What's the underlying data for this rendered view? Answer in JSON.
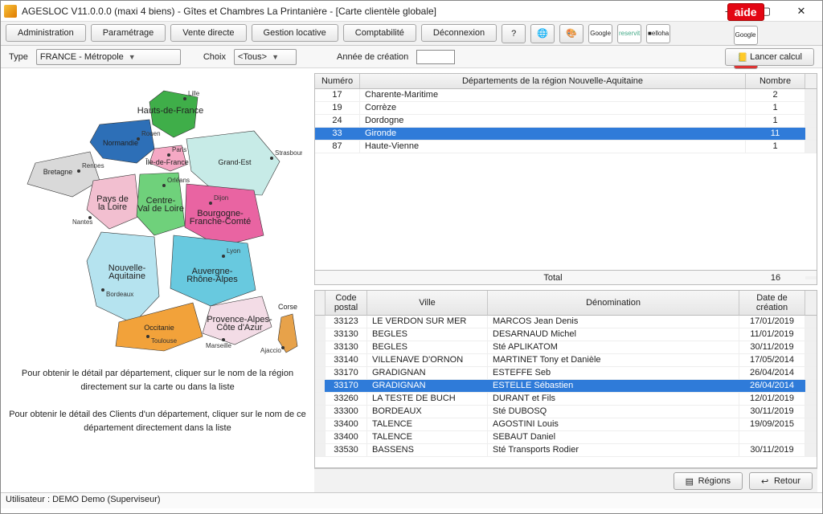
{
  "window": {
    "title": "AGESLOC V11.0.0.0 (maxi 4 biens) - Gîtes et Chambres La Printanière - [Carte clientèle globale]"
  },
  "toolbar": {
    "admin": "Administration",
    "param": "Paramétrage",
    "vente": "Vente directe",
    "gestion": "Gestion locative",
    "compta": "Comptabilité",
    "deco": "Déconnexion",
    "help": "?",
    "aide": "aide"
  },
  "logos": {
    "google": "Google",
    "reservit": "reservit",
    "elloha": "■elloha"
  },
  "filter": {
    "type_label": "Type",
    "type_value": "FRANCE - Métropole",
    "choix_label": "Choix",
    "choix_value": "<Tous>",
    "annee_label": "Année de création",
    "lancer": "Lancer calcul"
  },
  "hint1": "Pour obtenir le détail par département, cliquer sur le nom de la région directement sur la carte ou dans la liste",
  "hint2": "Pour obtenir le détail des Clients d'un département, cliquer sur le nom de ce département directement dans la liste",
  "grid1": {
    "col_num": "Numéro",
    "col_dep": "Départements de la région Nouvelle-Aquitaine",
    "col_nom": "Nombre",
    "rows": [
      {
        "num": "17",
        "dep": "Charente-Maritime",
        "n": "2"
      },
      {
        "num": "19",
        "dep": "Corrèze",
        "n": "1"
      },
      {
        "num": "24",
        "dep": "Dordogne",
        "n": "1"
      },
      {
        "num": "33",
        "dep": "Gironde",
        "n": "11",
        "sel": true
      },
      {
        "num": "87",
        "dep": "Haute-Vienne",
        "n": "1"
      }
    ],
    "total_label": "Total",
    "total_val": "16"
  },
  "grid2": {
    "col_cp": "Code postal",
    "col_ville": "Ville",
    "col_den": "Dénomination",
    "col_date": "Date de création",
    "rows": [
      {
        "cp": "33123",
        "ville": "LE VERDON SUR MER",
        "den": "MARCOS Jean Denis",
        "date": "17/01/2019"
      },
      {
        "cp": "33130",
        "ville": "BEGLES",
        "den": "DESARNAUD Michel",
        "date": "11/01/2019"
      },
      {
        "cp": "33130",
        "ville": "BEGLES",
        "den": "Sté APLIKATOM",
        "date": "30/11/2019"
      },
      {
        "cp": "33140",
        "ville": "VILLENAVE D'ORNON",
        "den": "MARTINET Tony et Danièle",
        "date": "17/05/2014"
      },
      {
        "cp": "33170",
        "ville": "GRADIGNAN",
        "den": "ESTEFFE Seb",
        "date": "26/04/2014"
      },
      {
        "cp": "33170",
        "ville": "GRADIGNAN",
        "den": "ESTELLE Sébastien",
        "date": "26/04/2014",
        "sel": true
      },
      {
        "cp": "33260",
        "ville": "LA TESTE DE BUCH",
        "den": "DURANT et Fils",
        "date": "12/01/2019"
      },
      {
        "cp": "33300",
        "ville": "BORDEAUX",
        "den": "Sté DUBOSQ",
        "date": "30/11/2019"
      },
      {
        "cp": "33400",
        "ville": "TALENCE",
        "den": "AGOSTINI Louis",
        "date": "19/09/2015"
      },
      {
        "cp": "33400",
        "ville": "TALENCE",
        "den": "SEBAUT Daniel",
        "date": ""
      },
      {
        "cp": "33530",
        "ville": "BASSENS",
        "den": "Sté Transports Rodier",
        "date": "30/11/2019"
      }
    ]
  },
  "footer": {
    "regions": "Régions",
    "retour": "Retour"
  },
  "status": "Utilisateur : DEMO Demo (Superviseur)",
  "map": {
    "regions": {
      "hdf": "Hauts-de-France",
      "nor": "Normandie",
      "idf": "Île-de-France",
      "ge": "Grand-Est",
      "bre": "Bretagne",
      "pdl": "Pays de\nla Loire",
      "cvl": "Centre-\nVal de Loire",
      "bfc": "Bourgogne-\nFranche-Comté",
      "na": "Nouvelle-\nAquitaine",
      "ara": "Auvergne-\nRhône-Alpes",
      "occ": "Occitanie",
      "paca": "Provence-Alpes-\nCôte d'Azur",
      "cor": "Corse"
    },
    "cities": {
      "lille": "Lille",
      "rouen": "Rouen",
      "paris": "Paris",
      "strasbourg": "Strasbourg",
      "rennes": "Rennes",
      "orleans": "Orléans",
      "nantes": "Nantes",
      "dijon": "Dijon",
      "lyon": "Lyon",
      "bordeaux": "Bordeaux",
      "toulouse": "Toulouse",
      "marseille": "Marseille",
      "ajaccio": "Ajaccio"
    }
  }
}
